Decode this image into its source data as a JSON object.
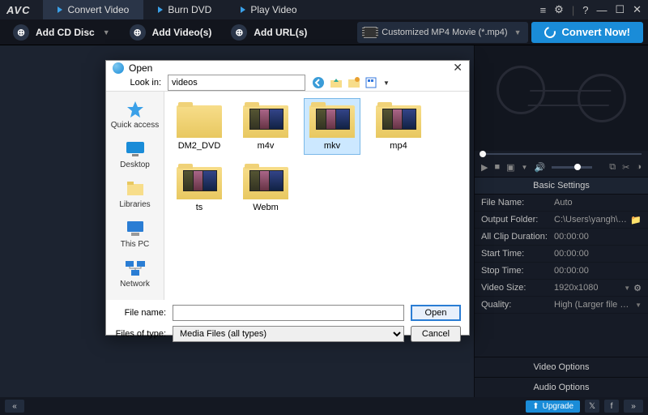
{
  "brand": "AVC",
  "tabs": {
    "convert": "Convert Video",
    "burn": "Burn DVD",
    "play": "Play Video"
  },
  "toolbar": {
    "add_disc": "Add CD Disc",
    "add_videos": "Add Video(s)",
    "add_urls": "Add URL(s)",
    "profile": "Customized MP4 Movie (*.mp4)",
    "convert": "Convert Now!"
  },
  "dialog": {
    "title": "Open",
    "look_in_label": "Look in:",
    "look_in_value": "videos",
    "places": {
      "quick": "Quick access",
      "desktop": "Desktop",
      "libraries": "Libraries",
      "pc": "This PC",
      "network": "Network"
    },
    "folders": [
      "DM2_DVD",
      "m4v",
      "mkv",
      "mp4",
      "ts",
      "Webm"
    ],
    "selected": "mkv",
    "file_name_label": "File name:",
    "file_name_value": "",
    "file_type_label": "Files of type:",
    "file_type_value": "Media Files (all types)",
    "open_btn": "Open",
    "cancel_btn": "Cancel"
  },
  "settings": {
    "header": "Basic Settings",
    "file_name_lbl": "File Name:",
    "file_name": "Auto",
    "output_lbl": "Output Folder:",
    "output": "C:\\Users\\yangh\\Videos...",
    "clip_lbl": "All Clip Duration:",
    "clip": "00:00:00",
    "start_lbl": "Start Time:",
    "start": "00:00:00",
    "stop_lbl": "Stop Time:",
    "stop": "00:00:00",
    "size_lbl": "Video Size:",
    "size": "1920x1080",
    "quality_lbl": "Quality:",
    "quality": "High (Larger file size)",
    "video_opts": "Video Options",
    "audio_opts": "Audio Options"
  },
  "bottom": {
    "upgrade": "Upgrade"
  }
}
